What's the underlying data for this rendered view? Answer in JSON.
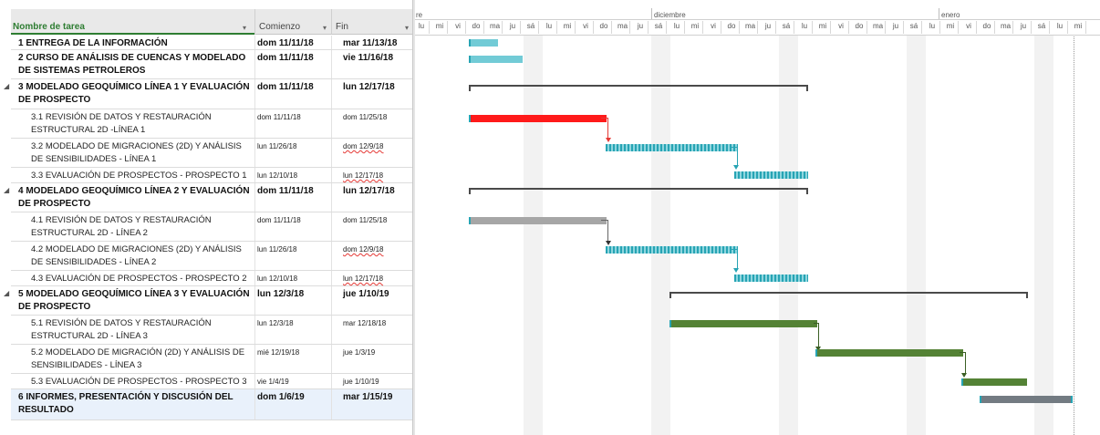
{
  "columns": {
    "task_name": "Nombre de tarea",
    "start": "Comienzo",
    "end": "Fin"
  },
  "timeline": {
    "months": [
      "re",
      "diciembre",
      "enero"
    ],
    "days": [
      "lu",
      "mi",
      "vi",
      "do",
      "ma",
      "ju",
      "sá",
      "lu",
      "mi",
      "vi",
      "do",
      "ma",
      "ju",
      "sá",
      "lu",
      "mi",
      "vi",
      "do",
      "ma",
      "ju",
      "sá",
      "lu",
      "mi",
      "vi",
      "do",
      "ma",
      "ju",
      "sá",
      "lu",
      "mi",
      "vi",
      "do",
      "ma",
      "ju",
      "sá",
      "lu",
      "mi"
    ]
  },
  "tasks": [
    {
      "name": "1 ENTREGA DE LA INFORMACIÓN",
      "start": "dom 11/11/18",
      "end": "mar 11/13/18"
    },
    {
      "name": "2 CURSO DE ANÁLISIS DE CUENCAS Y MODELADO DE SISTEMAS PETROLEROS",
      "start": "dom 11/11/18",
      "end": "vie 11/16/18"
    },
    {
      "name": "3 MODELADO GEOQUÍMICO LÍNEA 1 Y EVALUACIÓN DE PROSPECTO",
      "start": "dom 11/11/18",
      "end": "lun 12/17/18"
    },
    {
      "name": "3.1 REVISIÓN DE DATOS Y RESTAURACIÓN ESTRUCTURAL 2D -LÍNEA 1",
      "start": "dom 11/11/18",
      "end": "dom 11/25/18"
    },
    {
      "name": "3.2 MODELADO DE MIGRACIONES (2D) Y ANÁLISIS DE SENSIBILIDADES - LÍNEA 1",
      "start": "lun 11/26/18",
      "end": "dom 12/9/18"
    },
    {
      "name": "3.3 EVALUACIÓN DE PROSPECTOS - PROSPECTO 1",
      "start": "lun 12/10/18",
      "end": "lun 12/17/18"
    },
    {
      "name": "4 MODELADO GEOQUÍMICO LÍNEA 2 Y EVALUACIÓN DE PROSPECTO",
      "start": "dom 11/11/18",
      "end": "lun 12/17/18"
    },
    {
      "name": "4.1 REVISIÓN DE DATOS Y RESTAURACIÓN ESTRUCTURAL 2D - LÍNEA 2",
      "start": "dom 11/11/18",
      "end": "dom 11/25/18"
    },
    {
      "name": "4.2 MODELADO DE MIGRACIONES (2D) Y ANÁLISIS DE SENSIBILIDADES - LÍNEA 2",
      "start": "lun 11/26/18",
      "end": "dom 12/9/18"
    },
    {
      "name": "4.3 EVALUACIÓN DE PROSPECTOS - PROSPECTO 2",
      "start": "lun 12/10/18",
      "end": "lun 12/17/18"
    },
    {
      "name": "5 MODELADO GEOQUÍMICO LÍNEA 3 Y EVALUACIÓN DE PROSPECTO",
      "start": "lun 12/3/18",
      "end": "jue 1/10/19"
    },
    {
      "name": "5.1 REVISIÓN DE DATOS Y RESTAURACIÓN ESTRUCTURAL 2D - LÍNEA 3",
      "start": "lun 12/3/18",
      "end": "mar 12/18/18"
    },
    {
      "name": "5.2 MODELADO DE MIGRACIÓN (2D) Y ANÁLISIS DE SENSIBILIDADES - LÍNEA 3",
      "start": "mié 12/19/18",
      "end": "jue 1/3/19"
    },
    {
      "name": "5.3 EVALUACIÓN DE PROSPECTOS - PROSPECTO 3",
      "start": "vie 1/4/19",
      "end": "jue 1/10/19"
    },
    {
      "name": "6 INFORMES, PRESENTACIÓN Y DISCUSIÓN DEL RESULTADO",
      "start": "dom 1/6/19",
      "end": "mar 1/15/19"
    }
  ],
  "colors": {
    "header_green": "#2e7d32",
    "bar_teal": "#72cbd6",
    "bar_red": "#ff1a1a",
    "bar_grey": "#a6a6a6",
    "bar_green": "#548235",
    "bar_dark_grey": "#737b82",
    "summary": "#4a4a4a"
  },
  "icons": {
    "collapse": "collapse-triangle-icon",
    "dropdown": "dropdown-arrow-icon"
  }
}
